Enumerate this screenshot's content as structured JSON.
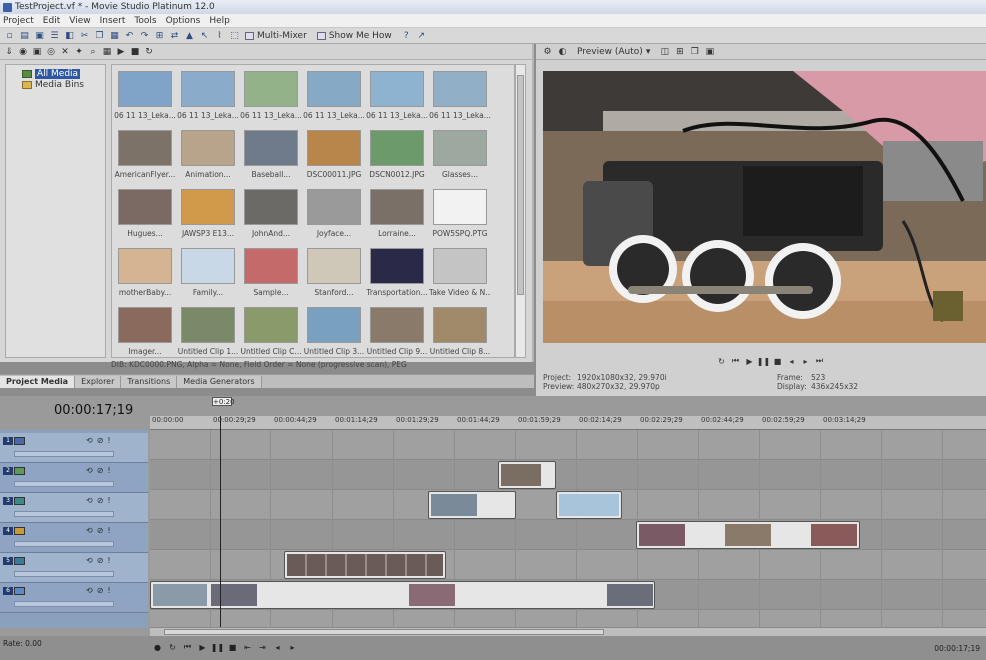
{
  "window": {
    "title": "TestProject.vf * - Movie Studio Platinum 12.0"
  },
  "menu": [
    "Project",
    "Edit",
    "View",
    "Insert",
    "Tools",
    "Options",
    "Help"
  ],
  "toolbar": {
    "multicam_label": "Multi-Mixer",
    "show_me_how_label": "Show Me How"
  },
  "explorer": {
    "tree": [
      {
        "label": "All Media",
        "selected": true
      },
      {
        "label": "Media Bins",
        "selected": false
      }
    ],
    "thumbnails": [
      {
        "caption": "06 11 13_Leka...",
        "color": "#7fa4c7"
      },
      {
        "caption": "06 11 13_Leka...",
        "color": "#8aabc9"
      },
      {
        "caption": "06 11 13_Leka...",
        "color": "#93b28a"
      },
      {
        "caption": "06 11 13_Leka...",
        "color": "#86a9c6"
      },
      {
        "caption": "06 11 13_Leka...",
        "color": "#8db3d0"
      },
      {
        "caption": "06 11 13_Leka...",
        "color": "#91b0c8"
      },
      {
        "caption": "AmericanFlyer...",
        "color": "#7d7268"
      },
      {
        "caption": "Animation...",
        "color": "#b8a48a"
      },
      {
        "caption": "Baseball...",
        "color": "#6f7a8a"
      },
      {
        "caption": "DSC00011.JPG",
        "color": "#b8864a"
      },
      {
        "caption": "DSCN0012.JPG",
        "color": "#6c9a6a"
      },
      {
        "caption": "Glasses...",
        "color": "#9ca8a0"
      },
      {
        "caption": "Hugues...",
        "color": "#7b6a64"
      },
      {
        "caption": "JAWSP3 E13...",
        "color": "#d19a4a"
      },
      {
        "caption": "JohnAnd...",
        "color": "#6b6a66"
      },
      {
        "caption": "Joyface...",
        "color": "#9a9a9a"
      },
      {
        "caption": "Lorraine...",
        "color": "#7a7068"
      },
      {
        "caption": "POW5SPQ.PTG",
        "color": "#f2f2f2"
      },
      {
        "caption": "motherBaby...",
        "color": "#d5b494"
      },
      {
        "caption": "Family...",
        "color": "#c9d8e6"
      },
      {
        "caption": "Sample...",
        "color": "#c46a6a"
      },
      {
        "caption": "Stanford...",
        "color": "#cfc8b8"
      },
      {
        "caption": "Transportation...",
        "color": "#2a2a48"
      },
      {
        "caption": "Take Video & N...",
        "color": "#c4c4c4"
      },
      {
        "caption": "Imager...",
        "color": "#8a6a5c"
      },
      {
        "caption": "Untitled Clip 1...",
        "color": "#7a8a68"
      },
      {
        "caption": "Untitled Clip C...",
        "color": "#8a9a6a"
      },
      {
        "caption": "Untitled Clip 3...",
        "color": "#7aa0c0"
      },
      {
        "caption": "Untitled Clip 9...",
        "color": "#8a7a6a"
      },
      {
        "caption": "Untitled Clip 8...",
        "color": "#a08a6a"
      }
    ],
    "status": "DIB: KDC0000.PNG, Alpha = None, Field Order = None (progressive scan), PEG"
  },
  "window_tabs": [
    {
      "label": "Project Media",
      "active": true
    },
    {
      "label": "Explorer",
      "active": false
    },
    {
      "label": "Transitions",
      "active": false
    },
    {
      "label": "Media Generators",
      "active": false
    }
  ],
  "preview": {
    "mode_label": "Preview (Auto)",
    "project_label": "Project:",
    "project_value": "1920x1080x32, 29.970i",
    "preview_label": "Preview:",
    "preview_value": "480x270x32, 29.970p",
    "frame_label": "Frame:",
    "frame_value": "523",
    "display_label": "Display:",
    "display_value": "436x245x32"
  },
  "timeline": {
    "current_time": "00:00:17;19",
    "marker": "+0:20",
    "ruler_ticks": [
      "00:00:00",
      "00:00:29;29",
      "00:00:44;29",
      "00:01:14;29",
      "00:01:29;29",
      "00:01:44;29",
      "00:01:59;29",
      "00:02:14;29",
      "00:02:29;29",
      "00:02:44;29",
      "00:02:59;29",
      "00:03:14;29"
    ],
    "tracks": [
      {
        "num": "1",
        "color": "#4a6aa8"
      },
      {
        "num": "2",
        "color": "#5a9a5a"
      },
      {
        "num": "3",
        "color": "#3a8a8a"
      },
      {
        "num": "4",
        "color": "#c89a3a"
      },
      {
        "num": "5",
        "color": "#3a7a9a"
      },
      {
        "num": "6",
        "color": "#5a8ac8"
      }
    ],
    "rate_label": "Rate: 0.00",
    "end_time": "00:00:17;19"
  }
}
